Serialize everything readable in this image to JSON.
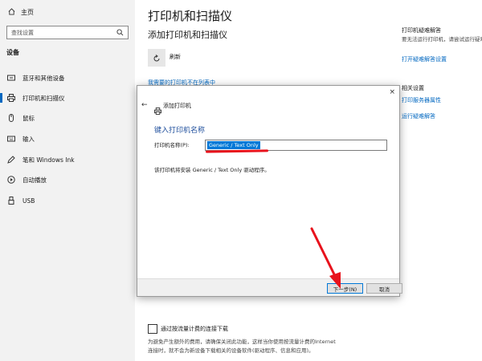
{
  "sidebar": {
    "home_label": "主页",
    "search_placeholder": "查找设置",
    "section_label": "设备",
    "items": [
      {
        "label": "蓝牙和其他设备",
        "icon": "bluetooth-icon"
      },
      {
        "label": "打印机和扫描仪",
        "icon": "printer-icon",
        "active": true
      },
      {
        "label": "鼠标",
        "icon": "mouse-icon"
      },
      {
        "label": "输入",
        "icon": "keyboard-icon"
      },
      {
        "label": "笔和 Windows Ink",
        "icon": "pen-icon"
      },
      {
        "label": "自动播放",
        "icon": "autoplay-icon"
      },
      {
        "label": "USB",
        "icon": "usb-icon"
      }
    ]
  },
  "main": {
    "page_title": "打印机和扫描仪",
    "sub_title": "添加打印机和扫描仪",
    "refresh_label": "刷新",
    "not_listed_link": "我需要的打印机不在列表中",
    "metered_label": "通过按流量计费的连接下载",
    "metered_desc": "为避免产生额外的费用，请确保关闭此功能，这样当你使用按流量计费的Internet 连接时，就不会为新设备下载相关的设备软件(驱动程序、信息和应用)。"
  },
  "right_column": {
    "troubleshoot_title": "打印机疑难解答",
    "troubleshoot_desc": "要无法运行打印机，请尝试运行疑难解答。",
    "troubleshoot_link": "打开疑难解答设置",
    "related_title": "相关设置",
    "related_link1": "打印服务器属性",
    "related_link2": "运行疑难解答"
  },
  "dialog": {
    "close_glyph": "×",
    "back_glyph": "←",
    "title": "添加打印机",
    "heading": "键入打印机名称",
    "name_label": "打印机名称(P):",
    "name_value": "Generic / Text Only",
    "info_text": "该打印机将安装 Generic / Text Only 驱动程序。",
    "next_button": "下一步(N)",
    "cancel_button": "取消"
  },
  "colors": {
    "accent": "#0067c0",
    "heading_blue": "#1e4e9c",
    "annotation_red": "#e8121c"
  }
}
